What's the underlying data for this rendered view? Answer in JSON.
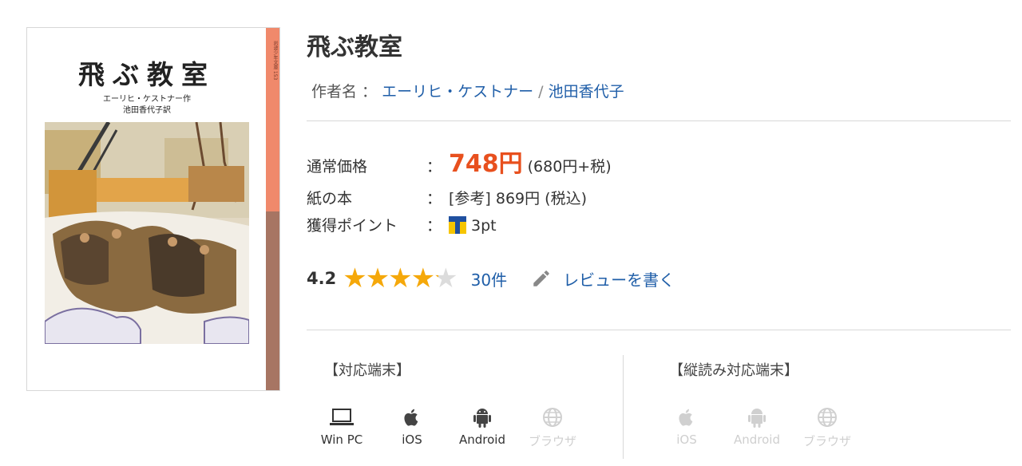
{
  "book": {
    "cover": {
      "title": "飛ぶ教室",
      "author_line": "エーリヒ・ケストナー作",
      "translator_line": "池田香代子訳",
      "spine_text": "岩波少年文庫 153"
    },
    "title": "飛ぶ教室",
    "author_label": "作者名 ：",
    "authors": [
      "エーリヒ・ケストナー",
      "池田香代子"
    ],
    "author_separator": "/"
  },
  "pricing": {
    "regular_label": "通常価格",
    "colon": "：",
    "price": "748円",
    "price_detail": "(680円+税)",
    "paper_label": "紙の本",
    "paper_value": "[参考] 869円 (税込)",
    "points_label": "獲得ポイント",
    "points_value": "3pt",
    "accent_color": "#e8501e"
  },
  "rating": {
    "score": "4.2",
    "stars_value": 4.2,
    "stars_max": 5,
    "review_count": "30件",
    "write_review": "レビューを書く"
  },
  "devices": {
    "supported_heading": "【対応端末】",
    "supported": [
      {
        "label": "Win PC",
        "icon": "laptop-icon",
        "enabled": true
      },
      {
        "label": "iOS",
        "icon": "apple-icon",
        "enabled": true
      },
      {
        "label": "Android",
        "icon": "android-icon",
        "enabled": true
      },
      {
        "label": "ブラウザ",
        "icon": "globe-icon",
        "enabled": false
      }
    ],
    "vertical_heading": "【縦読み対応端末】",
    "vertical": [
      {
        "label": "iOS",
        "icon": "apple-icon",
        "enabled": false
      },
      {
        "label": "Android",
        "icon": "android-icon",
        "enabled": false
      },
      {
        "label": "ブラウザ",
        "icon": "globe-icon",
        "enabled": false
      }
    ]
  }
}
